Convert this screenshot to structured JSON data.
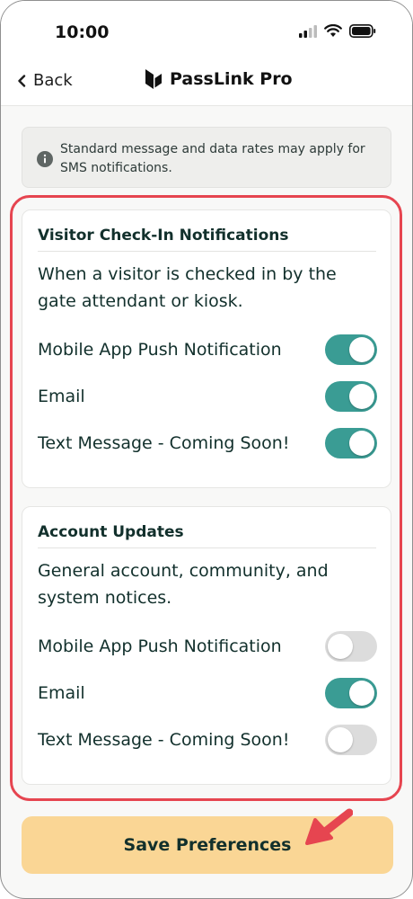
{
  "status_bar": {
    "time": "10:00"
  },
  "nav": {
    "back_label": "Back",
    "brand_name": "PassLink",
    "brand_suffix": "Pro"
  },
  "info": {
    "icon": "info-icon",
    "text": "Standard message and data rates may apply for SMS notifications."
  },
  "sections": [
    {
      "title": "Visitor Check-In Notifications",
      "description": "When a visitor is checked in by the gate attendant or kiosk.",
      "rows": [
        {
          "label": "Mobile App Push Notification",
          "enabled": true
        },
        {
          "label": "Email",
          "enabled": true
        },
        {
          "label": "Text Message - Coming Soon!",
          "enabled": true
        }
      ]
    },
    {
      "title": "Account Updates",
      "description": "General account, community, and system notices.",
      "rows": [
        {
          "label": "Mobile App Push Notification",
          "enabled": false
        },
        {
          "label": "Email",
          "enabled": true
        },
        {
          "label": "Text Message - Coming Soon!",
          "enabled": false
        }
      ]
    }
  ],
  "save_button": {
    "label": "Save Preferences"
  },
  "colors": {
    "toggle_on": "#3a9c94",
    "toggle_off": "#dcdcdc",
    "save_button_bg": "#fad695",
    "highlight_border": "#e64550"
  }
}
